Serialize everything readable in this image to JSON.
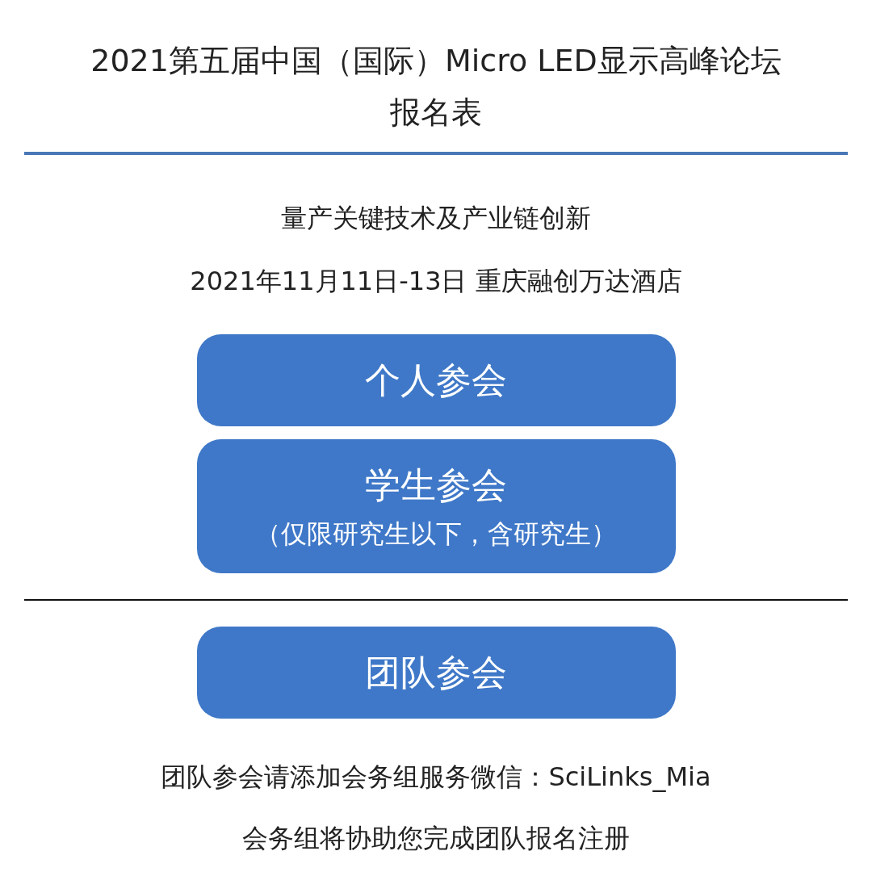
{
  "title": {
    "lines": [
      "2021第五届中国（国际）Micro LED显示高峰论坛",
      "报名表"
    ]
  },
  "info": [
    "量产关键技术及产业链创新",
    "2021年11月11日-13日 重庆融创万达酒店"
  ],
  "options": [
    {
      "label": "个人参会"
    },
    {
      "label": "学生参会",
      "note": "（仅限研究生以下，含研究生）"
    }
  ],
  "group_option": {
    "label": "团队参会"
  },
  "notes": [
    "团队参会请添加会务组服务微信：SciLinks_Mia",
    "会务组将协助您完成团队报名注册"
  ]
}
